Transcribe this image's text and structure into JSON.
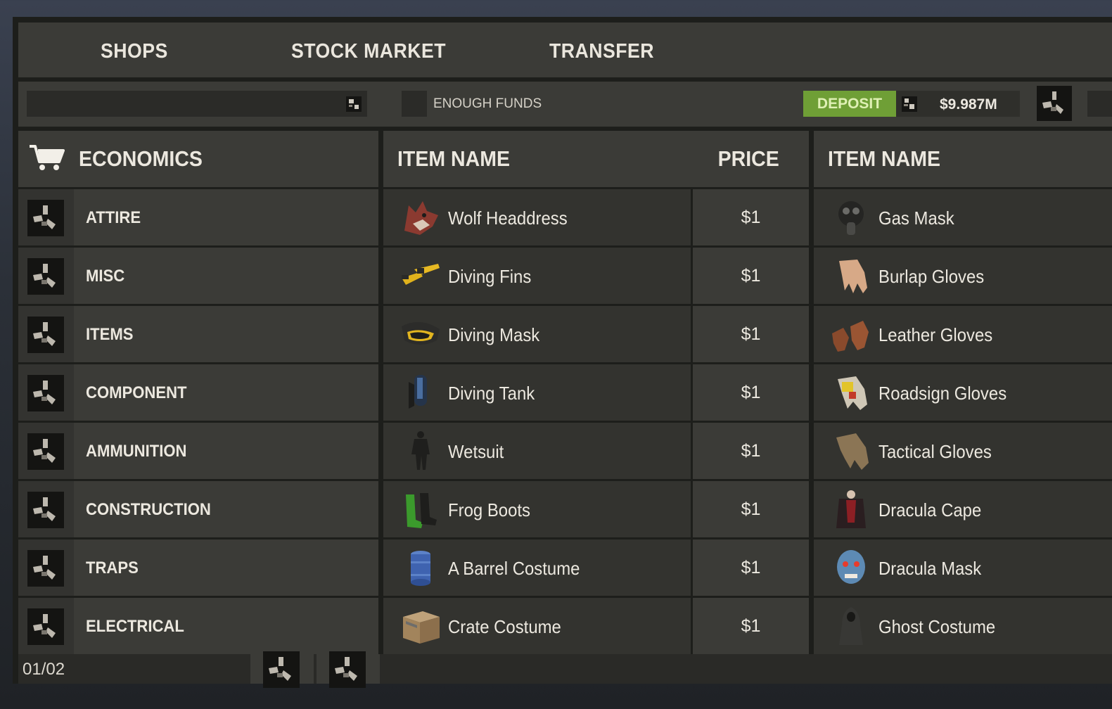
{
  "tabs": [
    "SHOPS",
    "STOCK MARKET",
    "TRANSFER"
  ],
  "toolbar": {
    "funds_filter_label": "ENOUGH FUNDS",
    "deposit_label": "DEPOSIT",
    "balance": "$9.987M"
  },
  "categories_header": "ECONOMICS",
  "categories": [
    "ATTIRE",
    "MISC",
    "ITEMS",
    "COMPONENT",
    "AMMUNITION",
    "CONSTRUCTION",
    "TRAPS",
    "ELECTRICAL"
  ],
  "pagination": {
    "page": "01/02"
  },
  "table_left": {
    "headers": {
      "name": "ITEM NAME",
      "price": "PRICE"
    },
    "items": [
      {
        "name": "Wolf Headdress",
        "price": "$1",
        "icon": "wolf-headdress-icon"
      },
      {
        "name": "Diving Fins",
        "price": "$1",
        "icon": "diving-fins-icon"
      },
      {
        "name": "Diving Mask",
        "price": "$1",
        "icon": "diving-mask-icon"
      },
      {
        "name": "Diving Tank",
        "price": "$1",
        "icon": "diving-tank-icon"
      },
      {
        "name": "Wetsuit",
        "price": "$1",
        "icon": "wetsuit-icon"
      },
      {
        "name": "Frog Boots",
        "price": "$1",
        "icon": "frog-boots-icon"
      },
      {
        "name": "A Barrel Costume",
        "price": "$1",
        "icon": "barrel-costume-icon"
      },
      {
        "name": "Crate Costume",
        "price": "$1",
        "icon": "crate-costume-icon"
      }
    ]
  },
  "table_right": {
    "headers": {
      "name": "ITEM NAME"
    },
    "items": [
      {
        "name": "Gas Mask",
        "icon": "gas-mask-icon"
      },
      {
        "name": "Burlap Gloves",
        "icon": "burlap-gloves-icon"
      },
      {
        "name": "Leather Gloves",
        "icon": "leather-gloves-icon"
      },
      {
        "name": "Roadsign Gloves",
        "icon": "roadsign-gloves-icon"
      },
      {
        "name": "Tactical Gloves",
        "icon": "tactical-gloves-icon"
      },
      {
        "name": "Dracula Cape",
        "icon": "dracula-cape-icon"
      },
      {
        "name": "Dracula Mask",
        "icon": "dracula-mask-icon"
      },
      {
        "name": "Ghost Costume",
        "icon": "ghost-costume-icon"
      }
    ]
  },
  "colors": {
    "deposit": "#6f9f36",
    "panel": "#3b3b37",
    "background": "#1d1e1b"
  }
}
